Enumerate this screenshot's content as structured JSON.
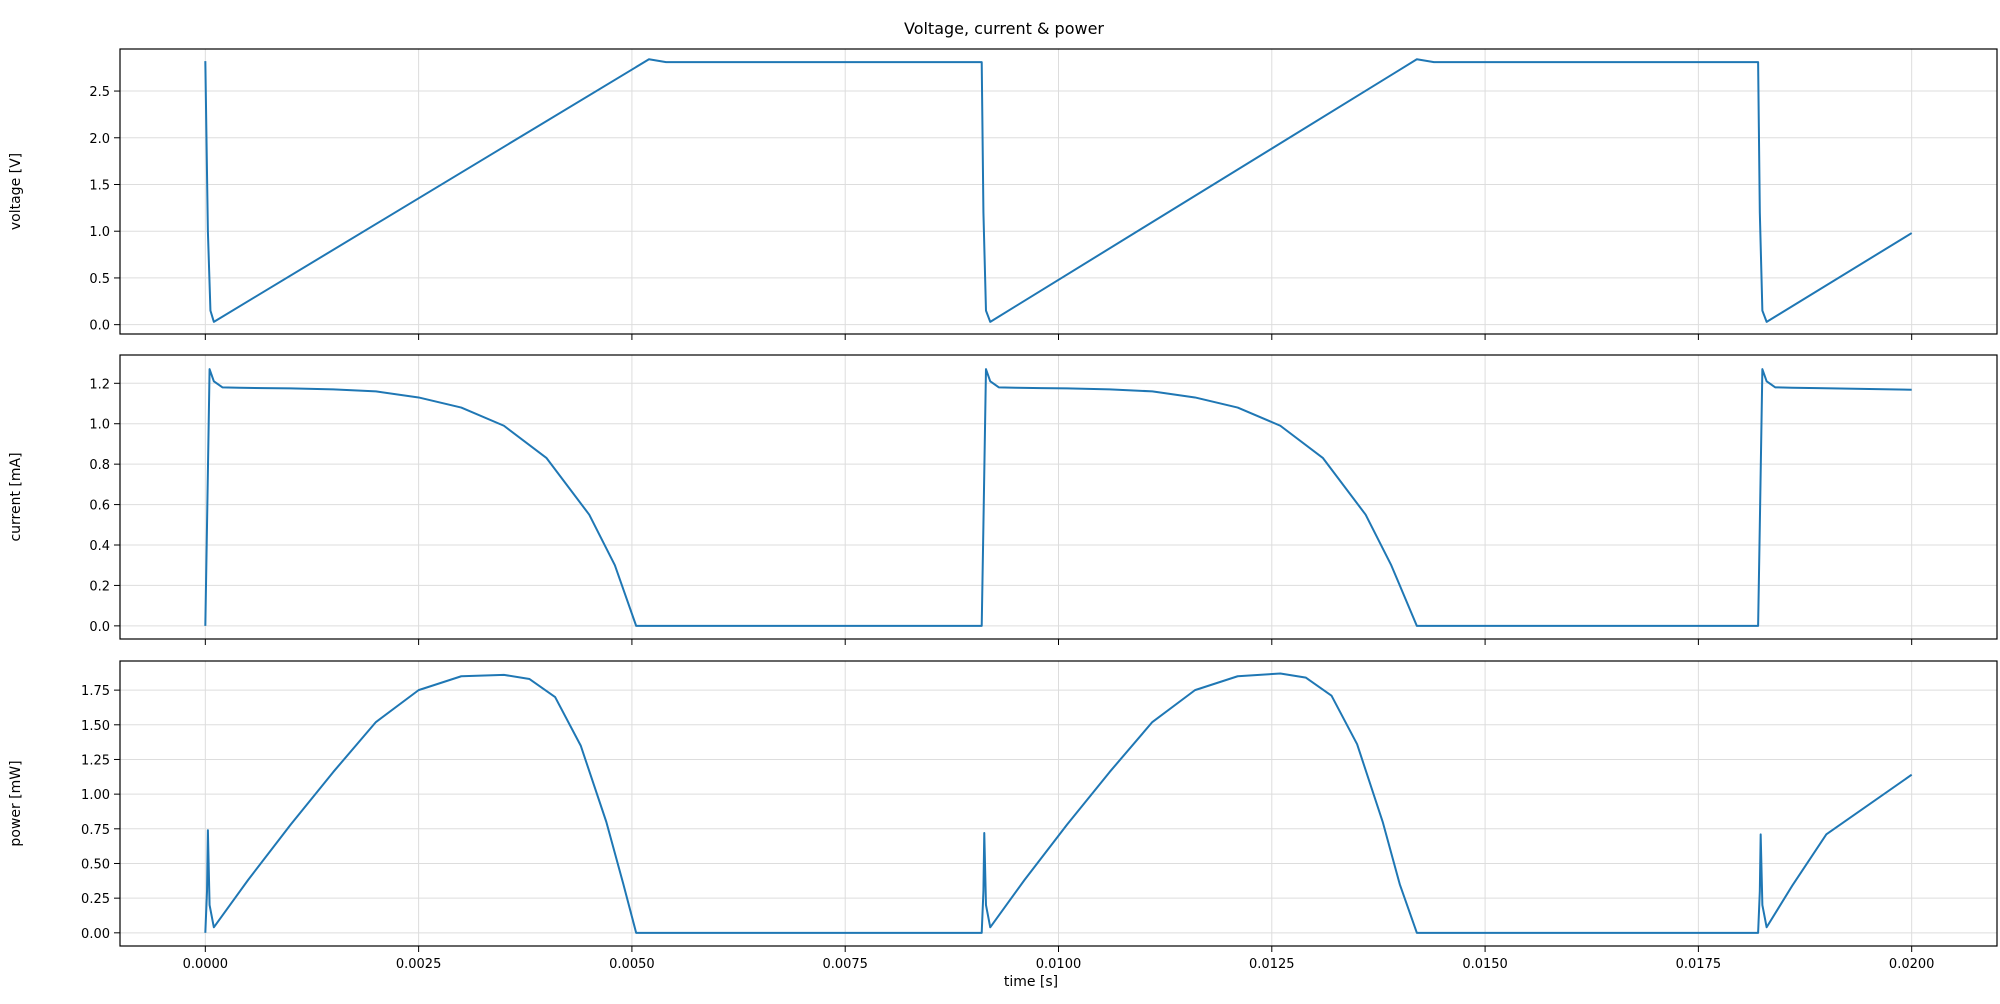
{
  "colors": {
    "line": "#1f77b4",
    "grid": "#dddddd",
    "frame": "#000000"
  },
  "chart_data": {
    "type": "line",
    "title": "Voltage, current & power",
    "xlabel": "time [s]",
    "xlim": [
      -0.001,
      0.021
    ],
    "xticks": [
      0.0,
      0.0025,
      0.005,
      0.0075,
      0.01,
      0.0125,
      0.015,
      0.0175,
      0.02
    ],
    "xtick_labels": [
      "0.0000",
      "0.0025",
      "0.0050",
      "0.0075",
      "0.0100",
      "0.0125",
      "0.0150",
      "0.0175",
      "0.0200"
    ],
    "grid": true,
    "shared_x": true,
    "panels": [
      {
        "ylabel": "voltage [V]",
        "ylim": [
          -0.1,
          2.95
        ],
        "yticks": [
          0.0,
          0.5,
          1.0,
          1.5,
          2.0,
          2.5
        ],
        "ytick_labels": [
          "0.0",
          "0.5",
          "1.0",
          "1.5",
          "2.0",
          "2.5"
        ],
        "x": [
          0.0,
          3e-05,
          6e-05,
          0.0001,
          0.0052,
          0.0054,
          0.0091,
          0.00912,
          0.00915,
          0.0092,
          0.0142,
          0.0144,
          0.0182,
          0.01822,
          0.01825,
          0.0183,
          0.02
        ],
        "y": [
          2.82,
          1.0,
          0.15,
          0.03,
          2.84,
          2.81,
          2.81,
          1.2,
          0.15,
          0.03,
          2.84,
          2.81,
          2.81,
          1.2,
          0.15,
          0.03,
          0.98
        ]
      },
      {
        "ylabel": "current [mA]",
        "ylim": [
          -0.065,
          1.34
        ],
        "yticks": [
          0.0,
          0.2,
          0.4,
          0.6,
          0.8,
          1.0,
          1.2
        ],
        "ytick_labels": [
          "0.0",
          "0.2",
          "0.4",
          "0.6",
          "0.8",
          "1.0",
          "1.2"
        ],
        "x": [
          0.0,
          2e-05,
          5e-05,
          0.0001,
          0.0002,
          0.0004,
          0.0007,
          0.001,
          0.0015,
          0.002,
          0.0025,
          0.003,
          0.0035,
          0.004,
          0.0045,
          0.0048,
          0.00505,
          0.0055,
          0.0091,
          0.00912,
          0.00915,
          0.0092,
          0.0093,
          0.0095,
          0.0098,
          0.0101,
          0.0106,
          0.0111,
          0.0116,
          0.0121,
          0.0126,
          0.0131,
          0.0136,
          0.0139,
          0.0142,
          0.0145,
          0.0182,
          0.01822,
          0.01825,
          0.0183,
          0.0184,
          0.0186,
          0.0189,
          0.02
        ],
        "y": [
          0.0,
          0.5,
          1.27,
          1.21,
          1.18,
          1.178,
          1.176,
          1.175,
          1.17,
          1.16,
          1.13,
          1.08,
          0.99,
          0.83,
          0.55,
          0.3,
          0.0,
          0.0,
          0.0,
          0.5,
          1.27,
          1.21,
          1.18,
          1.178,
          1.176,
          1.175,
          1.17,
          1.16,
          1.13,
          1.08,
          0.99,
          0.83,
          0.55,
          0.3,
          0.0,
          0.0,
          0.0,
          0.5,
          1.27,
          1.21,
          1.18,
          1.178,
          1.176,
          1.168
        ]
      },
      {
        "ylabel": "power [mW]",
        "ylim": [
          -0.095,
          1.96
        ],
        "yticks": [
          0.0,
          0.25,
          0.5,
          0.75,
          1.0,
          1.25,
          1.5,
          1.75
        ],
        "ytick_labels": [
          "0.00",
          "0.25",
          "0.50",
          "0.75",
          "1.00",
          "1.25",
          "1.50",
          "1.75"
        ],
        "x": [
          0.0,
          2e-05,
          3e-05,
          5e-05,
          0.0001,
          0.0005,
          0.001,
          0.0015,
          0.002,
          0.0025,
          0.003,
          0.0035,
          0.0038,
          0.0041,
          0.0044,
          0.0047,
          0.0049,
          0.00505,
          0.006,
          0.0091,
          0.00912,
          0.00913,
          0.00915,
          0.0092,
          0.0096,
          0.0101,
          0.0106,
          0.0111,
          0.0116,
          0.0121,
          0.0126,
          0.0129,
          0.0132,
          0.0135,
          0.0138,
          0.014,
          0.0142,
          0.015,
          0.0182,
          0.01822,
          0.01823,
          0.01825,
          0.0183,
          0.0186,
          0.019,
          0.02
        ],
        "y": [
          0.0,
          0.3,
          0.74,
          0.2,
          0.04,
          0.38,
          0.78,
          1.16,
          1.52,
          1.75,
          1.85,
          1.86,
          1.83,
          1.7,
          1.35,
          0.8,
          0.35,
          0.0,
          0.0,
          0.0,
          0.3,
          0.72,
          0.2,
          0.04,
          0.38,
          0.78,
          1.16,
          1.52,
          1.75,
          1.85,
          1.87,
          1.84,
          1.71,
          1.36,
          0.8,
          0.35,
          0.0,
          0.0,
          0.0,
          0.3,
          0.71,
          0.2,
          0.04,
          0.34,
          0.71,
          1.14
        ]
      }
    ]
  }
}
